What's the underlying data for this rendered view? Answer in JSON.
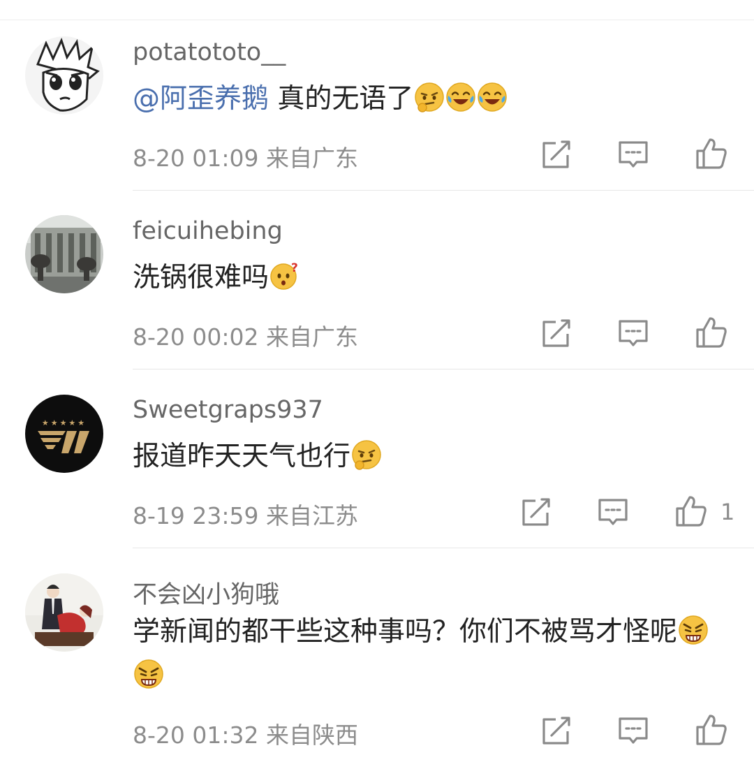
{
  "comments": [
    {
      "username": "potatototo__",
      "mention": "@阿歪养鹅",
      "text": " 真的无语了",
      "emojis": [
        "thinking-face-emoji",
        "laughing-tears-emoji",
        "laughing-tears-emoji"
      ],
      "time": "8-20 01:09",
      "location": "来自广东",
      "likes": ""
    },
    {
      "username": "feicuihebing",
      "mention": "",
      "text": "洗锅很难吗",
      "emojis": [
        "puzzled-face-emoji"
      ],
      "time": "8-20 00:02",
      "location": "来自广东",
      "likes": ""
    },
    {
      "username": "Sweetgraps937",
      "mention": "",
      "text": "报道昨天天气也行",
      "emojis": [
        "thinking-face-emoji"
      ],
      "time": "8-19 23:59",
      "location": "来自江苏",
      "likes": "1"
    },
    {
      "username": "不会凶小狗哦",
      "mention": "",
      "text": "学新闻的都干些这种事吗？你们不被骂才怪呢",
      "emojis": [
        "angry-face-emoji",
        "angry-face-emoji"
      ],
      "time": "8-20 01:32",
      "location": "来自陕西",
      "likes": ""
    }
  ],
  "colors": {
    "username": "#666666",
    "text": "#222222",
    "mention": "#4a6fae",
    "meta": "#8c8c8c",
    "icon": "#8a8a8a"
  }
}
